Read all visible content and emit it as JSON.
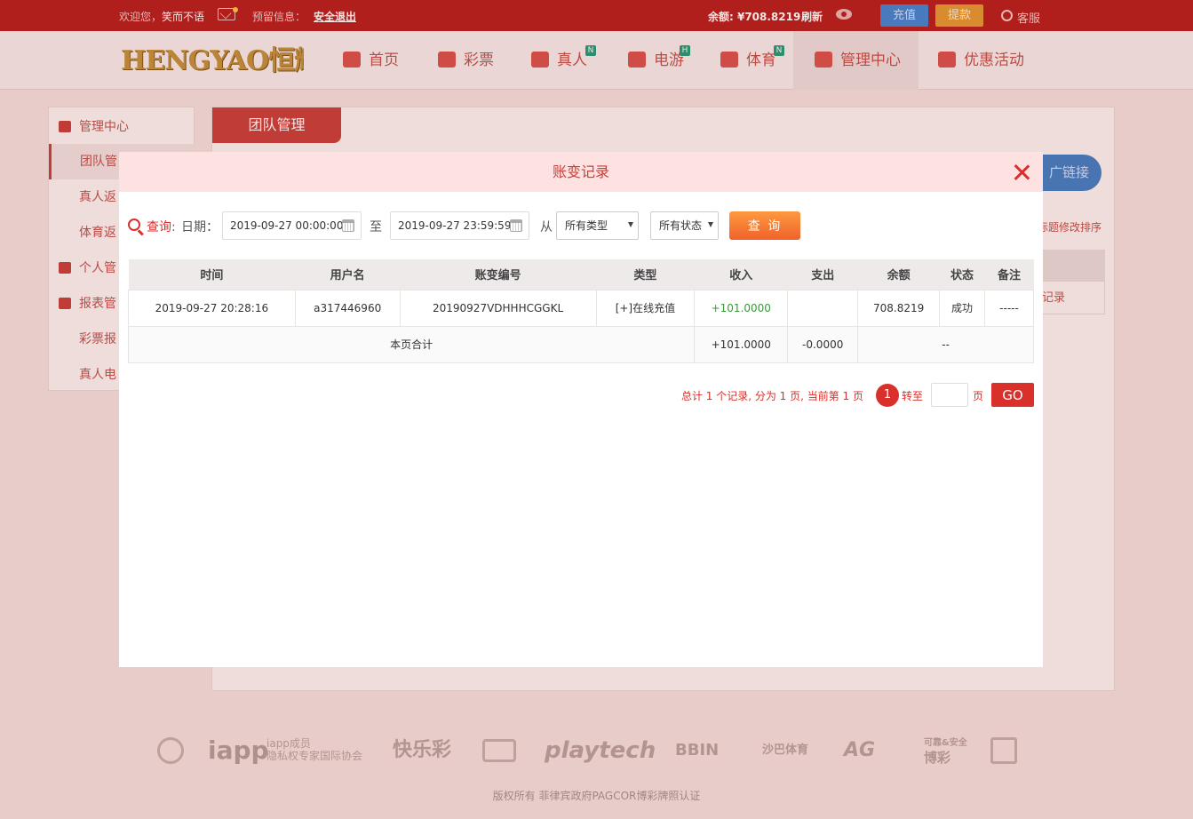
{
  "topbar": {
    "welcome_prefix": "欢迎您，",
    "username": "笑而不语",
    "notice_label": "预留信息：",
    "logout": "安全退出",
    "balance": "余额: ¥708.8219",
    "refresh": "刷新",
    "recharge": "充值",
    "withdraw": "提款",
    "service": "客服"
  },
  "header": {
    "logo_text": "HENGYAO恒耀",
    "nav": [
      {
        "label": "首页",
        "badge": ""
      },
      {
        "label": "彩票",
        "badge": ""
      },
      {
        "label": "真人",
        "badge": "N"
      },
      {
        "label": "电游",
        "badge": "H"
      },
      {
        "label": "体育",
        "badge": "N"
      },
      {
        "label": "管理中心",
        "badge": ""
      },
      {
        "label": "优惠活动",
        "badge": ""
      }
    ]
  },
  "sidebar": {
    "items": [
      {
        "label": "管理中心"
      },
      {
        "label": "团队管"
      },
      {
        "label": "真人返"
      },
      {
        "label": "体育返"
      },
      {
        "label": "个人管"
      },
      {
        "label": "报表管"
      },
      {
        "label": "彩票报"
      },
      {
        "label": "真人电"
      }
    ]
  },
  "content": {
    "tab": "团队管理",
    "promo_link": "广链接",
    "sort_text": "标题修改排序",
    "bg_cell": "记录"
  },
  "modal": {
    "title": "账变记录",
    "query_label": "查询:",
    "date_label": "日期：",
    "start_date": "2019-09-27 00:00:00",
    "to_label": "至",
    "end_date": "2019-09-27 23:59:59",
    "from_label": "从",
    "type_select": "所有类型",
    "status_select": "所有状态",
    "query_button": "查 询",
    "table": {
      "headers": [
        "时间",
        "用户名",
        "账变编号",
        "类型",
        "收入",
        "支出",
        "余额",
        "状态",
        "备注"
      ],
      "rows": [
        [
          "2019-09-27 20:28:16",
          "a317446960",
          "20190927VDHHHCGGKL",
          "[+]在线充值",
          "+101.0000",
          "",
          "708.8219",
          "成功",
          "-----"
        ]
      ],
      "total": {
        "label": "本页合计",
        "income": "+101.0000",
        "expense": "-0.0000",
        "rest": "--"
      }
    },
    "pagination": {
      "summary": "总计 1 个记录, 分为 1 页, 当前第 1 页",
      "current": "1",
      "goto_label": "转至",
      "unit": "页",
      "go": "GO"
    }
  },
  "footer": {
    "partners": [
      "iapp",
      "iapp成员",
      "隐私权专家国际协会",
      "快乐彩",
      "playtech",
      "BBIN",
      "沙巴体育",
      "AG",
      "可靠&安全",
      "博彩"
    ],
    "copyright": "版权所有 菲律宾政府PAGCOR博彩牌照认证"
  }
}
